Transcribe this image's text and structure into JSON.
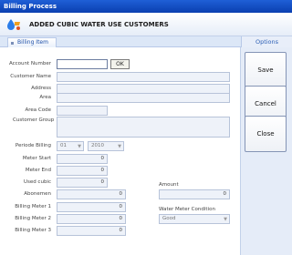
{
  "window": {
    "title": "Billing Process"
  },
  "header": {
    "title": "ADDED CUBIC WATER USE CUSTOMERS",
    "logo_icon": "water-drop-logo-icon"
  },
  "tabs": {
    "billing_item": "Billing Item",
    "options": "Options"
  },
  "form": {
    "account_number": {
      "label": "Account Number",
      "value": ""
    },
    "ok_label": "OK",
    "customer_name": {
      "label": "Customer Name",
      "value": ""
    },
    "address": {
      "label": "Address",
      "value": ""
    },
    "area": {
      "label": "Area",
      "value": ""
    },
    "area_code": {
      "label": "Area Code",
      "value": ""
    },
    "customer_group": {
      "label": "Customer Group",
      "value": ""
    },
    "periode_billing": {
      "label": "Periode Billing",
      "month": "01",
      "year": "2010"
    },
    "meter_start": {
      "label": "Meter Start",
      "value": "0"
    },
    "meter_end": {
      "label": "Meter End",
      "value": "0"
    },
    "used_cubic": {
      "label": "Used cubic",
      "value": "0"
    },
    "abonemen": {
      "label": "Abonemen",
      "value": "0"
    },
    "billing_meter_1": {
      "label": "Billing Meter 1",
      "value": "0"
    },
    "billing_meter_2": {
      "label": "Billing Meter 2",
      "value": "0"
    },
    "billing_meter_3": {
      "label": "Billing Meter 3",
      "value": "0"
    },
    "amount": {
      "label": "Amount",
      "value": "0"
    },
    "water_meter_condition": {
      "label": "Water Meter Condition",
      "value": "Good"
    }
  },
  "actions": {
    "save": "Save",
    "cancel": "Cancel",
    "close": "Close"
  },
  "colors": {
    "titlebar": "#0a3fb0",
    "accent": "#2c5fb5",
    "panel": "#e5ecf8"
  }
}
